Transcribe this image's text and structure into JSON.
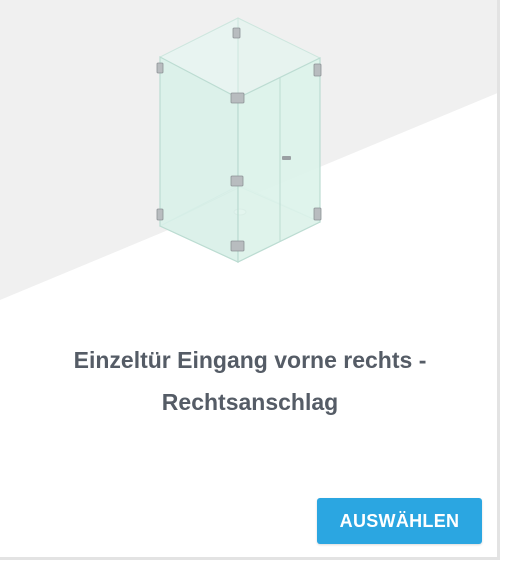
{
  "card": {
    "title_line1": "Einzeltür Eingang vorne rechts -",
    "title_line2": "Rechtsanschlag",
    "button_label": "AUSWÄHLEN"
  },
  "colors": {
    "accent": "#2ba6e1",
    "title_text": "#555c66",
    "backdrop": "#f0f0f0",
    "glass": "#d8f0e8"
  },
  "image": {
    "icon": "glass-shower-enclosure-icon"
  }
}
